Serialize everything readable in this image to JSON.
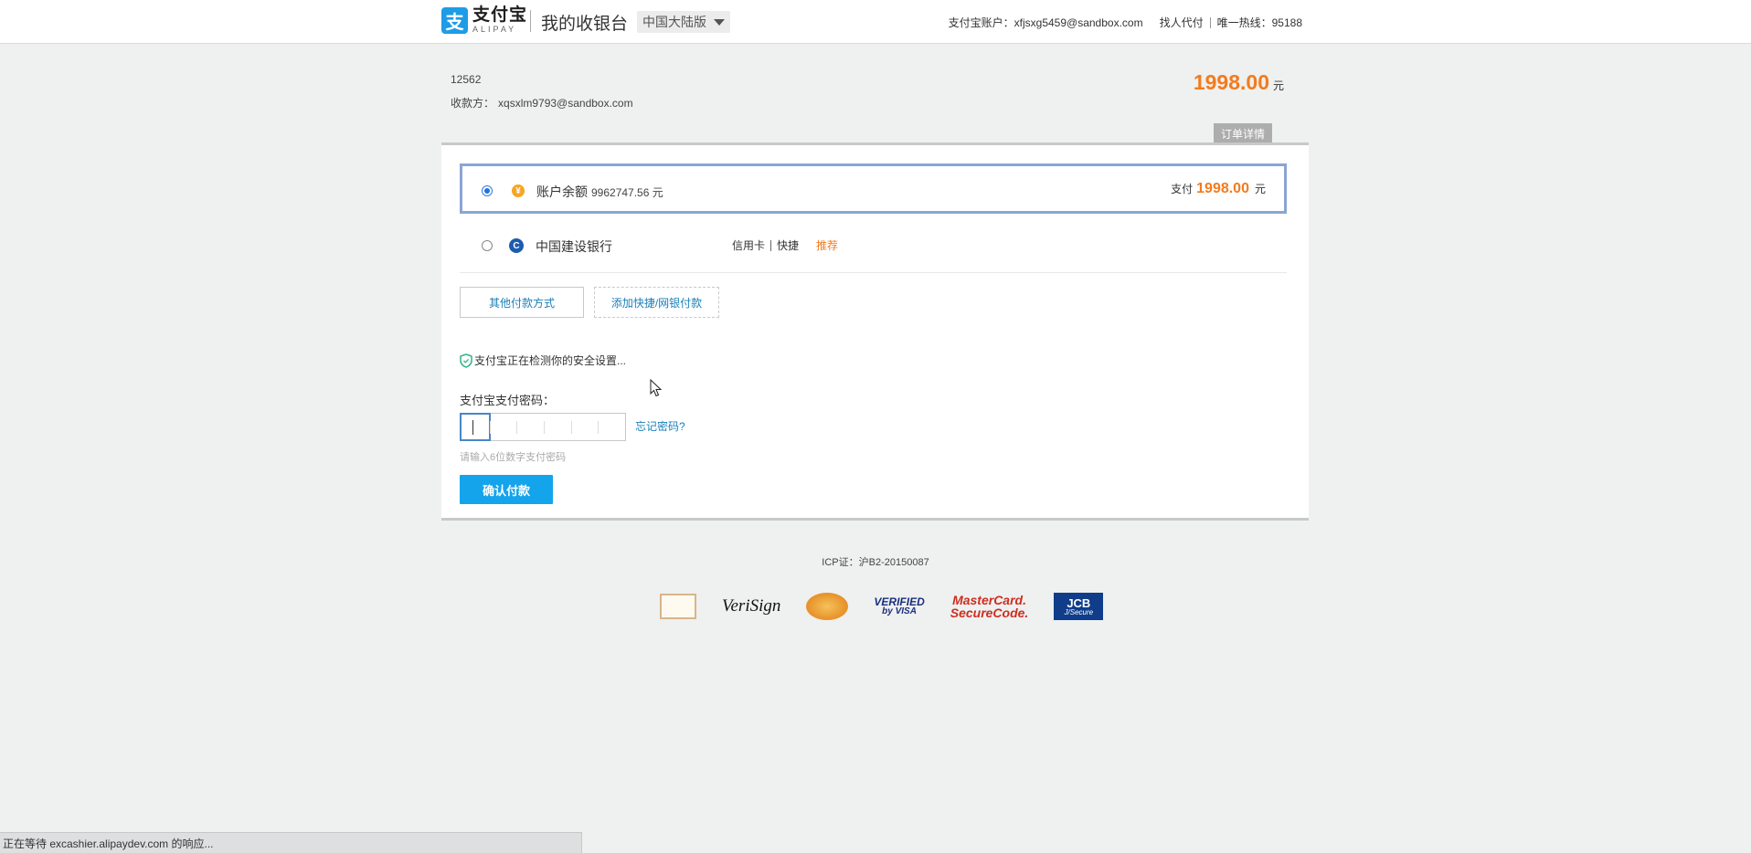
{
  "header": {
    "logo_cn": "支付宝",
    "logo_en": "ALIPAY",
    "app_title": "我的收银台",
    "region": "中国大陆版",
    "account_label": "支付宝账户：",
    "account_email": "xfjsxg5459@sandbox.com",
    "find_payer": "找人代付",
    "hotline_label": "唯一热线：",
    "hotline_number": "95188"
  },
  "order": {
    "id": "12562",
    "payee_label": "收款方：",
    "payee_email": "xqsxlm9793@sandbox.com",
    "amount": "1998.00",
    "currency": "元",
    "detail_tab": "订单详情"
  },
  "payment_options": [
    {
      "label": "账户余额",
      "balance": "9962747.56 元",
      "selected": true,
      "pay_prefix": "支付",
      "pay_amount": "1998.00",
      "pay_unit": "元"
    },
    {
      "label": "中国建设银行",
      "tags": [
        "信用卡",
        "快捷"
      ],
      "recommend": "推荐",
      "selected": false
    }
  ],
  "buttons": {
    "other_methods": "其他付款方式",
    "add_quick": "添加快捷/网银付款",
    "confirm": "确认付款"
  },
  "security": {
    "checking": "支付宝正在检测你的安全设置...",
    "password_label": "支付宝支付密码：",
    "forgot": "忘记密码?",
    "hint": "请输入6位数字支付密码"
  },
  "footer": {
    "icp": "ICP证：沪B2-20150087",
    "certs": {
      "verisign": "VeriSign",
      "visa_line1": "VERIFIED",
      "visa_line2": "by VISA",
      "mc_line1": "MasterCard.",
      "mc_line2": "SecureCode.",
      "jcb_line1": "JCB",
      "jcb_line2": "J/Secure"
    }
  },
  "status_bar": "正在等待 excashier.alipaydev.com 的响应...",
  "colors": {
    "accent_orange": "#f37b1d",
    "link_blue": "#1a7fb8",
    "confirm_blue": "#14a4ec",
    "selected_border": "#8aa5d3",
    "alipay_blue": "#1e9ce6"
  }
}
